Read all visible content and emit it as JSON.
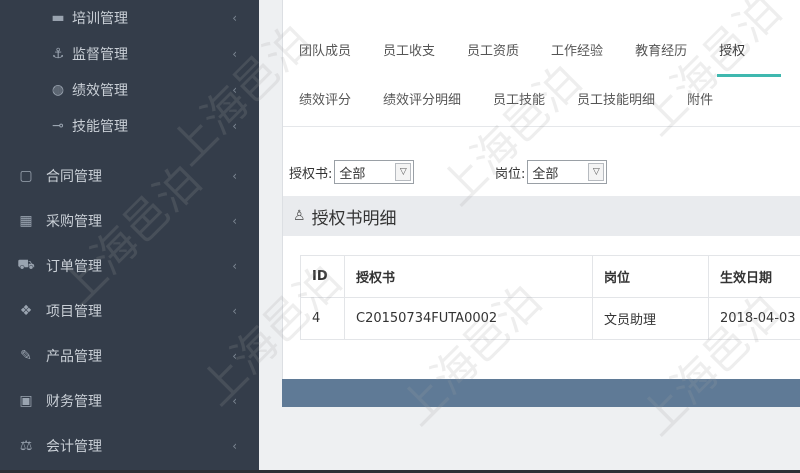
{
  "sidebar": {
    "items": [
      {
        "label": "培训管理",
        "icon": "briefcase-icon",
        "glyph": "▬",
        "sub": true
      },
      {
        "label": "监督管理",
        "icon": "anchor-icon",
        "glyph": "⚓",
        "sub": true
      },
      {
        "label": "绩效管理",
        "icon": "dashboard-icon",
        "glyph": "◍",
        "sub": true
      },
      {
        "label": "技能管理",
        "icon": "key-icon",
        "glyph": "⊸",
        "sub": true
      },
      {
        "label": "合同管理",
        "icon": "document-icon",
        "glyph": "▢",
        "sub": false
      },
      {
        "label": "采购管理",
        "icon": "box-icon",
        "glyph": "▦",
        "sub": false
      },
      {
        "label": "订单管理",
        "icon": "cart-icon",
        "glyph": "⛟",
        "sub": false
      },
      {
        "label": "项目管理",
        "icon": "cubes-icon",
        "glyph": "❖",
        "sub": false
      },
      {
        "label": "产品管理",
        "icon": "edit-icon",
        "glyph": "✎",
        "sub": false
      },
      {
        "label": "财务管理",
        "icon": "money-icon",
        "glyph": "▣",
        "sub": false
      },
      {
        "label": "会计管理",
        "icon": "scale-icon",
        "glyph": "⚖",
        "sub": false
      }
    ],
    "chevron": "‹"
  },
  "tabs_row1": [
    "团队成员",
    "员工收支",
    "员工资质",
    "工作经验",
    "教育经历",
    "授权"
  ],
  "tabs_row2": [
    "绩效评分",
    "绩效评分明细",
    "员工技能",
    "员工技能明细",
    "附件"
  ],
  "filters": {
    "auth_label": "授权书:",
    "auth_value": "全部",
    "post_label": "岗位:",
    "post_value": "全部"
  },
  "section_title": "授权书明细",
  "table": {
    "headers": [
      "ID",
      "授权书",
      "岗位",
      "生效日期"
    ],
    "rows": [
      [
        "4",
        "C20150734FUTA0002",
        "文员助理",
        "2018-04-03"
      ]
    ]
  },
  "watermark": "上海邑泊",
  "colors": {
    "sidebar_bg": "#343d4a",
    "accent": "#3fb8af",
    "footer_bar": "#5f7a96"
  }
}
